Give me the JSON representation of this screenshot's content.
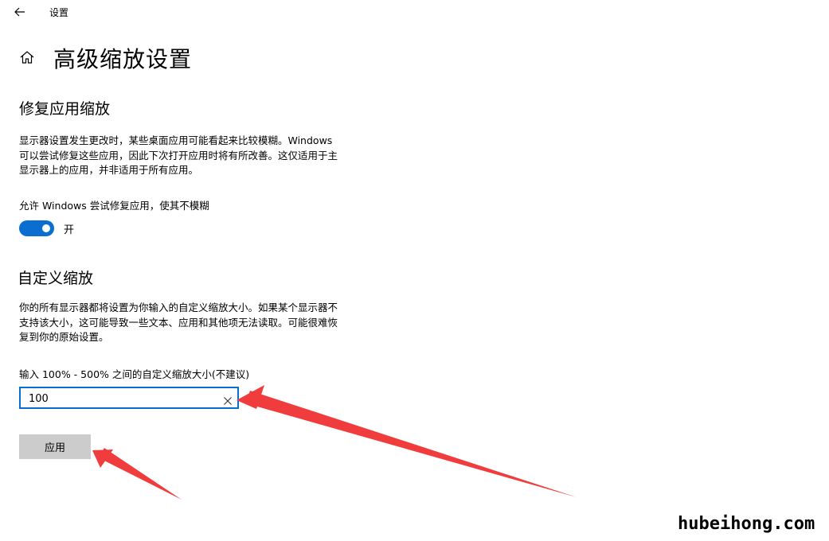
{
  "window": {
    "title": "设置"
  },
  "page": {
    "title": "高级缩放设置"
  },
  "fix_scaling": {
    "heading": "修复应用缩放",
    "description_lines": [
      "显示器设置发生更改时，某些桌面应用可能看起来比较模糊。Windows",
      "可以尝试修复这些应用，因此下次打开应用时将有所改善。这仅适用于主",
      "显示器上的应用，并非适用于所有应用。"
    ],
    "toggle_label": "允许 Windows 尝试修复应用，使其不模糊",
    "toggle_state_text": "开",
    "toggle_on": true
  },
  "custom_scaling": {
    "heading": "自定义缩放",
    "description_lines": [
      "你的所有显示器都将设置为你输入的自定义缩放大小。如果某个显示器不",
      "支持该大小，这可能导致一些文本、应用和其他项无法读取。可能很难恢",
      "复到你的原始设置。"
    ],
    "input_label": "输入 100% - 500% 之间的自定义缩放大小(不建议)",
    "input_value": "100",
    "apply_label": "应用"
  },
  "watermark": "hubeihong.com",
  "colors": {
    "accent": "#0a6ed1",
    "arrow": "#f03c3c",
    "button_bg": "#cccccc"
  }
}
